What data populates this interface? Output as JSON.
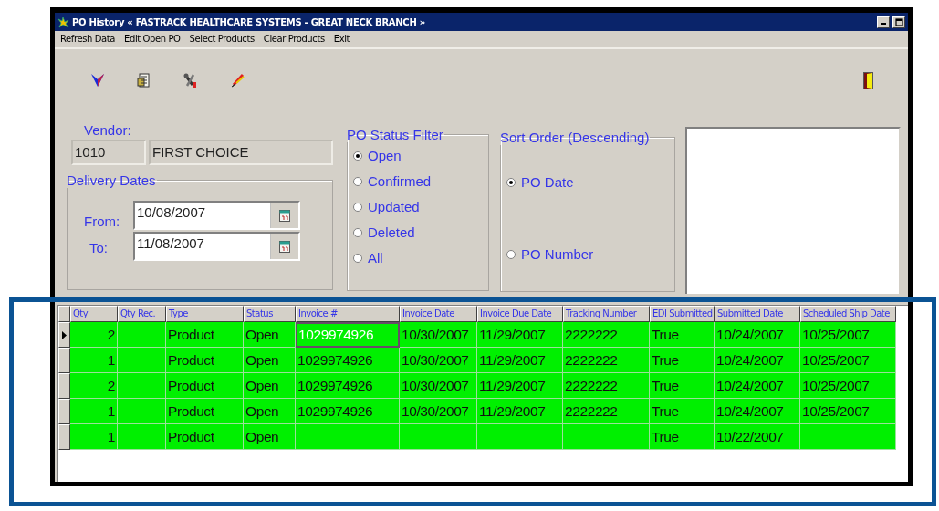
{
  "window": {
    "title": "PO History « FASTRACK HEALTHCARE SYSTEMS - GREAT NECK BRANCH »"
  },
  "menu": [
    "Refresh Data",
    "Edit Open PO",
    "Select Products",
    "Clear Products",
    "Exit"
  ],
  "vendor": {
    "label": "Vendor:",
    "code": "1010",
    "name": "FIRST CHOICE"
  },
  "delivery_dates": {
    "title": "Delivery Dates",
    "from_label": "From:",
    "from": "10/08/2007",
    "to_label": "To:",
    "to": "11/08/2007"
  },
  "po_status_filter": {
    "title": "PO Status Filter",
    "options": [
      {
        "label": "Open",
        "selected": true
      },
      {
        "label": "Confirmed",
        "selected": false
      },
      {
        "label": "Updated",
        "selected": false
      },
      {
        "label": "Deleted",
        "selected": false
      },
      {
        "label": "All",
        "selected": false
      }
    ]
  },
  "sort_order": {
    "title": "Sort Order (Descending)",
    "options": [
      {
        "label": "PO Date",
        "selected": true
      },
      {
        "label": "PO Number",
        "selected": false
      }
    ]
  },
  "table": {
    "columns": [
      {
        "label": "Qty",
        "kind": "number"
      },
      {
        "label": "Qty Rec.",
        "kind": "number"
      },
      {
        "label": "Type",
        "kind": "text"
      },
      {
        "label": "Status",
        "kind": "text"
      },
      {
        "label": "Invoice #",
        "kind": "text"
      },
      {
        "label": "Invoice Date",
        "kind": "text"
      },
      {
        "label": "Invoice Due Date",
        "kind": "text"
      },
      {
        "label": "Tracking Number",
        "kind": "text"
      },
      {
        "label": "EDI Submitted",
        "kind": "text"
      },
      {
        "label": "Submitted Date",
        "kind": "text"
      },
      {
        "label": "Scheduled Ship Date",
        "kind": "text"
      }
    ],
    "rows": [
      {
        "selected": true,
        "cells": [
          "2",
          null,
          "Product",
          "Open",
          {
            "text": "1029974926",
            "focused": true
          },
          "10/30/2007",
          "11/29/2007",
          "2222222",
          "True",
          "10/24/2007",
          "10/25/2007"
        ]
      },
      {
        "selected": false,
        "cells": [
          "1",
          null,
          "Product",
          "Open",
          "1029974926",
          "10/30/2007",
          "11/29/2007",
          "2222222",
          "True",
          "10/24/2007",
          "10/25/2007"
        ]
      },
      {
        "selected": false,
        "cells": [
          "2",
          null,
          "Product",
          "Open",
          "1029974926",
          "10/30/2007",
          "11/29/2007",
          "2222222",
          "True",
          "10/24/2007",
          "10/25/2007"
        ]
      },
      {
        "selected": false,
        "cells": [
          "1",
          null,
          "Product",
          "Open",
          "1029974926",
          "10/30/2007",
          "11/29/2007",
          "2222222",
          "True",
          "10/24/2007",
          "10/25/2007"
        ]
      },
      {
        "selected": false,
        "cells": [
          "1",
          null,
          "Product",
          "Open",
          null,
          null,
          null,
          null,
          "True",
          "10/22/2007",
          null
        ]
      }
    ]
  }
}
